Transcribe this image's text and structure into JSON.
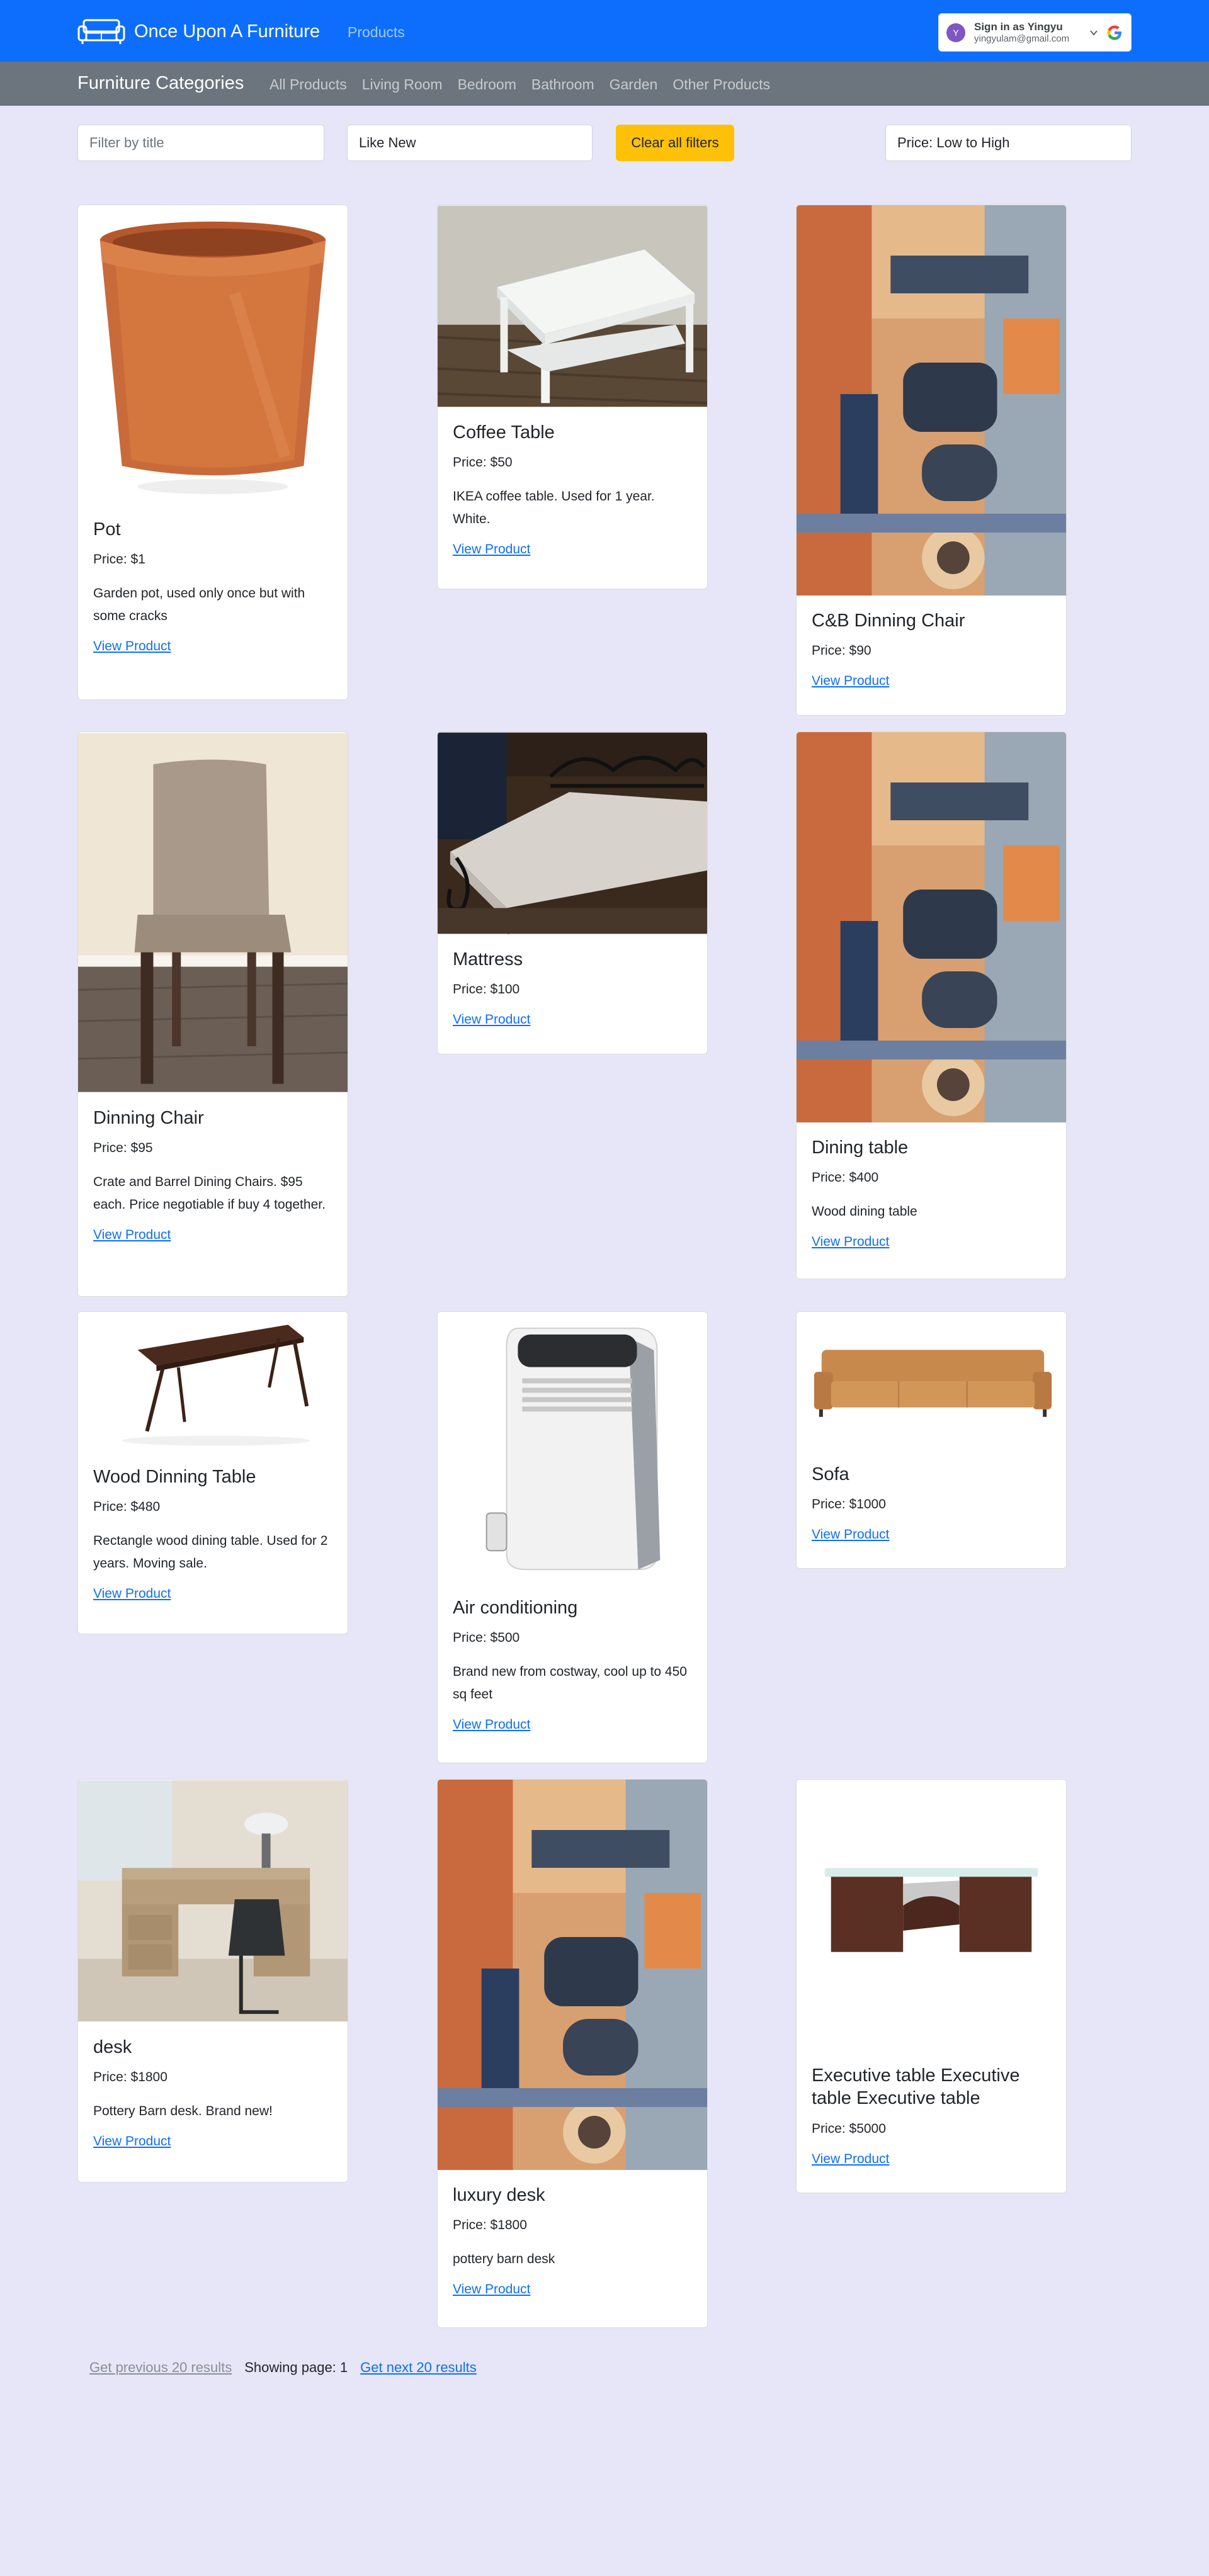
{
  "navbar": {
    "brand": "Once Upon A Furniture",
    "products_link": "Products",
    "brand_color": "#0d6efd",
    "signin": {
      "title": "Sign in as Yingyu",
      "email": "yingyulam@gmail.com",
      "avatar_letter": "Y"
    }
  },
  "categories": {
    "title": "Furniture Categories",
    "links": [
      "All Products",
      "Living Room",
      "Bedroom",
      "Bathroom",
      "Garden",
      "Other Products"
    ]
  },
  "filters": {
    "title_placeholder": "Filter by title",
    "condition_value": "Like New",
    "clear_label": "Clear all filters",
    "sort_value": "Price: Low to High"
  },
  "products": [
    {
      "title": "Pot",
      "price": "Price: $1",
      "description": "Garden pot, used only once but with some cracks",
      "link": "View Product",
      "image": "terracotta-pot"
    },
    {
      "title": "Coffee Table",
      "price": "Price: $50",
      "description": "IKEA coffee table. Used for 1 year. White.",
      "link": "View Product",
      "image": "white-coffee-table"
    },
    {
      "title": "C&B Dinning Chair",
      "price": "Price: $90",
      "description": "",
      "link": "View Product",
      "image": "abstract-painting"
    },
    {
      "title": "Dinning Chair",
      "price": "Price: $95",
      "description": "Crate and Barrel Dining Chairs. $95 each. Price negotiable if buy 4 together.",
      "link": "View Product",
      "image": "upholstered-chair"
    },
    {
      "title": "Mattress",
      "price": "Price: $100",
      "description": "",
      "link": "View Product",
      "image": "mattress-on-bed-frame"
    },
    {
      "title": "Dining table",
      "price": "Price: $400",
      "description": "Wood dining table",
      "link": "View Product",
      "image": "abstract-painting"
    },
    {
      "title": "Wood Dinning Table",
      "price": "Price: $480",
      "description": "Rectangle wood dining table. Used for 2 years. Moving sale.",
      "link": "View Product",
      "image": "wood-dining-table"
    },
    {
      "title": "Air conditioning",
      "price": "Price: $500",
      "description": "Brand new from costway, cool up to 450 sq feet",
      "link": "View Product",
      "image": "portable-air-conditioner"
    },
    {
      "title": "Sofa",
      "price": "Price: $1000",
      "description": "",
      "link": "View Product",
      "image": "tan-sofa"
    },
    {
      "title": "desk",
      "price": "Price: $1800",
      "description": "Pottery Barn desk. Brand new!",
      "link": "View Product",
      "image": "wooden-desk"
    },
    {
      "title": "luxury desk",
      "price": "Price: $1800",
      "description": "pottery barn desk",
      "link": "View Product",
      "image": "abstract-painting"
    },
    {
      "title": "Executive table Executive table Executive table",
      "price": "Price: $5000",
      "description": "",
      "link": "View Product",
      "image": "executive-table"
    }
  ],
  "pagination": {
    "prev": "Get previous 20 results",
    "showing": "Showing page: 1",
    "next": "Get next 20 results"
  }
}
